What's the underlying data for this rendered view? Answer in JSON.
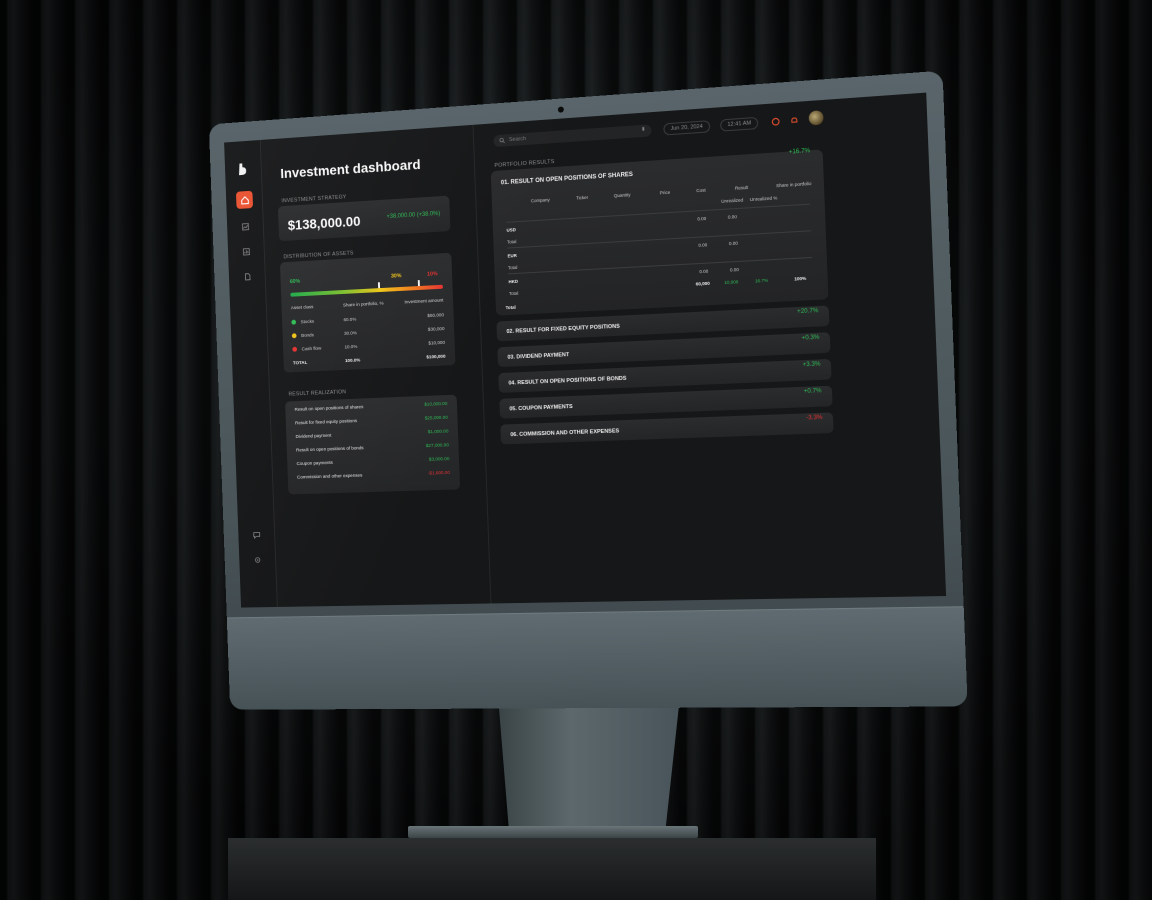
{
  "header": {
    "title": "Investment dashboard",
    "search_placeholder": "Search",
    "date": "Jun 20, 2024",
    "time": "12:41 AM"
  },
  "strategy": {
    "label": "INVESTMENT STRATEGY",
    "amount": "$138,000.00",
    "delta": "+38,000.00 (+38.0%)"
  },
  "distribution": {
    "label": "DISTRIBUTION OF ASSETS",
    "markers": [
      {
        "label": "60%",
        "color": "#2fbd55"
      },
      {
        "label": "30%",
        "color": "#f0c419"
      },
      {
        "label": "10%",
        "color": "#e53232"
      }
    ],
    "columns": [
      "Asset class",
      "Share in portfolio, %",
      "Investment amount"
    ],
    "rows": [
      {
        "name": "Stocks",
        "share": "60.0%",
        "amount": "$60,000",
        "color": "#2fbd55"
      },
      {
        "name": "Bonds",
        "share": "30.0%",
        "amount": "$30,000",
        "color": "#f0c419"
      },
      {
        "name": "Cash flow",
        "share": "10.0%",
        "amount": "$10,000",
        "color": "#e53232"
      }
    ],
    "total": {
      "name": "TOTAL",
      "share": "100.0%",
      "amount": "$100,000"
    }
  },
  "realization": {
    "label": "RESULT REALIZATION",
    "rows": [
      {
        "name": "Result on open positions of shares",
        "value": "$10,000.00",
        "neg": false
      },
      {
        "name": "Result for fixed equity positions",
        "value": "$25,000.00",
        "neg": false
      },
      {
        "name": "Dividend payment",
        "value": "$1,000.00",
        "neg": false
      },
      {
        "name": "Result on open positions of bonds",
        "value": "$27,000.00",
        "neg": false
      },
      {
        "name": "Coupon payments",
        "value": "$3,000.00",
        "neg": false
      },
      {
        "name": "Commission and other expenses",
        "value": "-$1,600.00",
        "neg": true
      }
    ]
  },
  "portfolio": {
    "label": "PORTFOLIO RESULTS",
    "main": {
      "title": "01. RESULT ON OPEN POSITIONS OF SHARES",
      "value": "+16.7%",
      "columns": [
        "Company",
        "Ticker",
        "Quantity",
        "Price",
        "Cost",
        "Result",
        "Share in portfolio"
      ],
      "subcolumns": [
        "Unrealized",
        "Unrealized %"
      ],
      "rows": [
        {
          "label": "USD",
          "cost": "0.00",
          "unreal": "0.00"
        },
        {
          "label": "Total"
        },
        {
          "label": "EUR",
          "cost": "0.00",
          "unreal": "0.00"
        },
        {
          "label": "Total"
        },
        {
          "label": "HKD",
          "cost": "0.00",
          "unreal": "0.00"
        },
        {
          "label": "Total",
          "cost": "60,000",
          "unreal": "10,000",
          "unreal_pct": "16.7%",
          "share": "100%"
        },
        {
          "label": "Total"
        }
      ]
    },
    "items": [
      {
        "title": "02. RESULT FOR FIXED EQUITY POSITIONS",
        "value": "+20.7%",
        "neg": false
      },
      {
        "title": "03. DIVIDEND PAYMENT",
        "value": "+0.3%",
        "neg": false
      },
      {
        "title": "04. RESULT ON OPEN POSITIONS OF BONDS",
        "value": "+3.3%",
        "neg": false
      },
      {
        "title": "05. COUPON PAYMENTS",
        "value": "+0.7%",
        "neg": false
      },
      {
        "title": "06. COMMISSION AND OTHER EXPENSES",
        "value": "-3.3%",
        "neg": true
      }
    ]
  },
  "icons": {
    "logo": "logo-icon",
    "home": "home-icon",
    "chart": "chart-icon",
    "report": "report-icon",
    "document": "document-icon",
    "chat": "chat-icon",
    "settings": "settings-icon",
    "mic": "mic-icon",
    "bell": "bell-icon",
    "notification": "notification-icon"
  },
  "colors": {
    "accent": "#e8512f",
    "positive": "#2fbd55",
    "negative": "#e53232",
    "warning": "#f0c419"
  }
}
